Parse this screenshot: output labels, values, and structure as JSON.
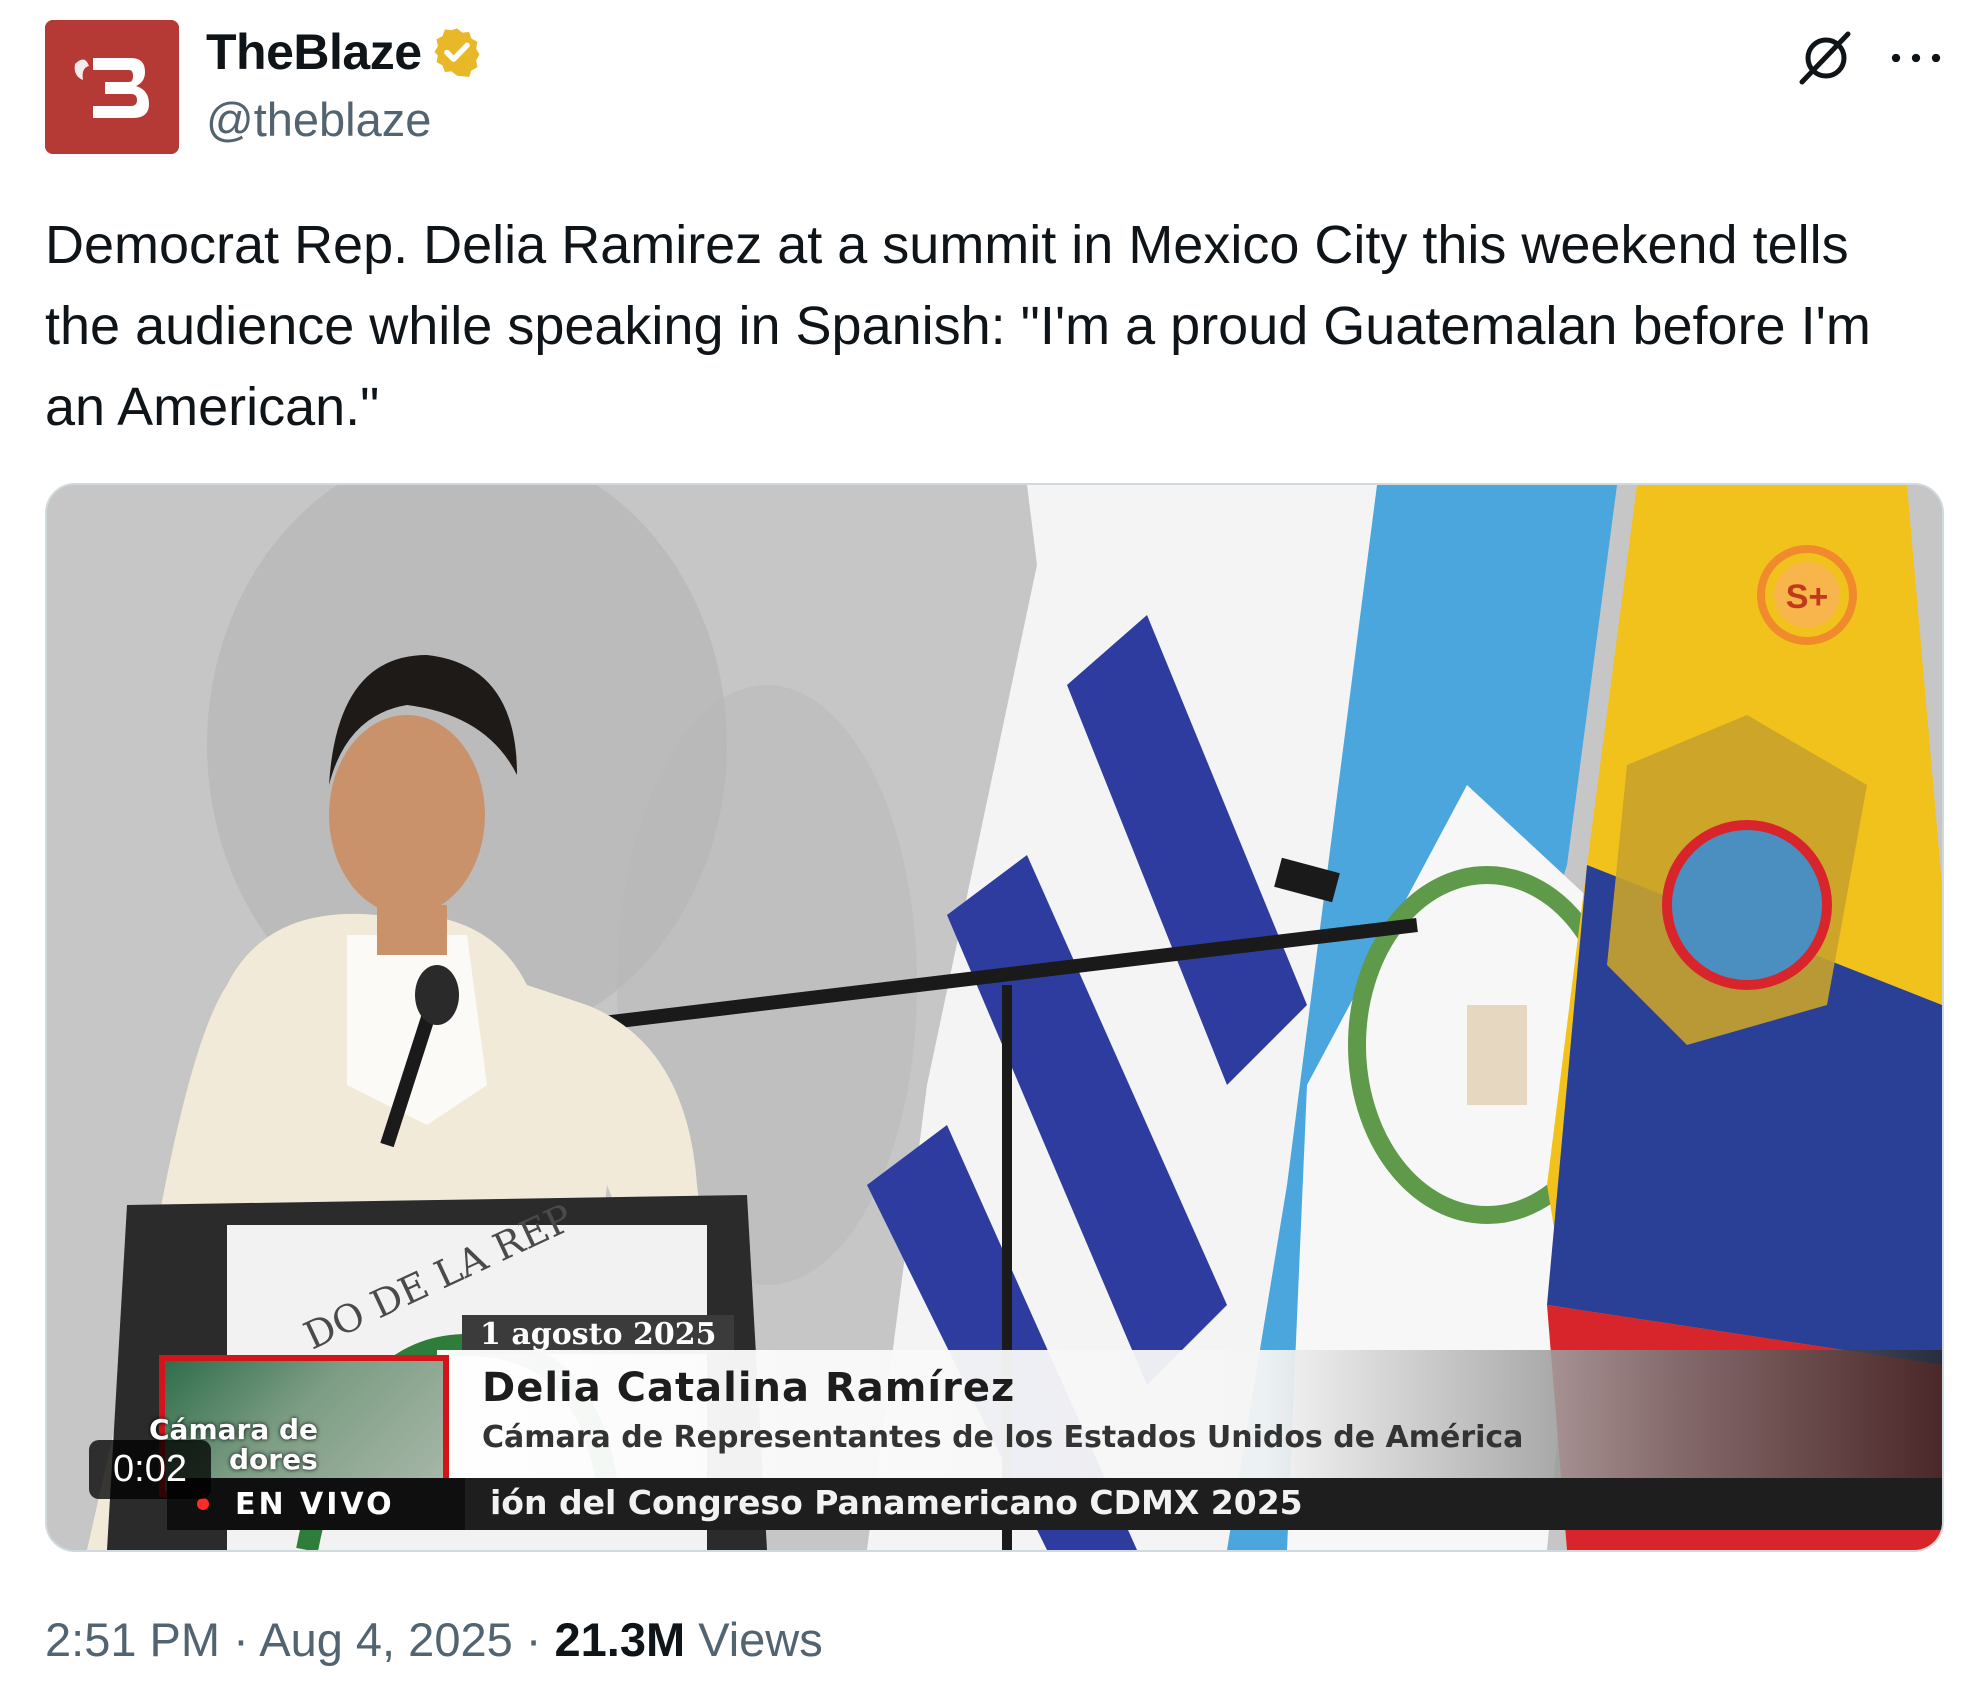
{
  "author": {
    "display_name": "TheBlaze",
    "handle": "@theblaze",
    "verified_badge_icon": "verified-gold-check-icon",
    "avatar_icon": "theblaze-logo-icon",
    "brand_color": "#b53a36"
  },
  "header_actions": {
    "grok_icon": "grok-icon",
    "more_icon": "more-horizontal-icon"
  },
  "tweet": {
    "text": "Democrat Rep. Delia Ramirez at a summit in Mexico City this weekend tells the audience while speaking in Spanish: \"I'm a proud Guatemalan before I'm an American.\""
  },
  "video": {
    "duration": "0:02",
    "date_tag": "1 agosto 2025",
    "chyron_name": "Delia Catalina Ramírez",
    "chyron_role": "Cámara de Representantes de los Estados Unidos de América",
    "bug_text_line1": "Cámara de",
    "bug_text_line2": "dores",
    "live_label": "EN VIVO",
    "ticker_text": "ión del Congreso Panamericano CDMX 2025",
    "podium_text": "DO DE LA REP",
    "channel_logo": "S+"
  },
  "meta": {
    "time": "2:51 PM",
    "separator": "·",
    "date": "Aug 4, 2025",
    "views_count": "21.3M",
    "views_label": "Views"
  },
  "colors": {
    "text_primary": "#0f1419",
    "text_secondary": "#536471",
    "border": "#cfd9de",
    "verified_gold": "#e8b829"
  }
}
